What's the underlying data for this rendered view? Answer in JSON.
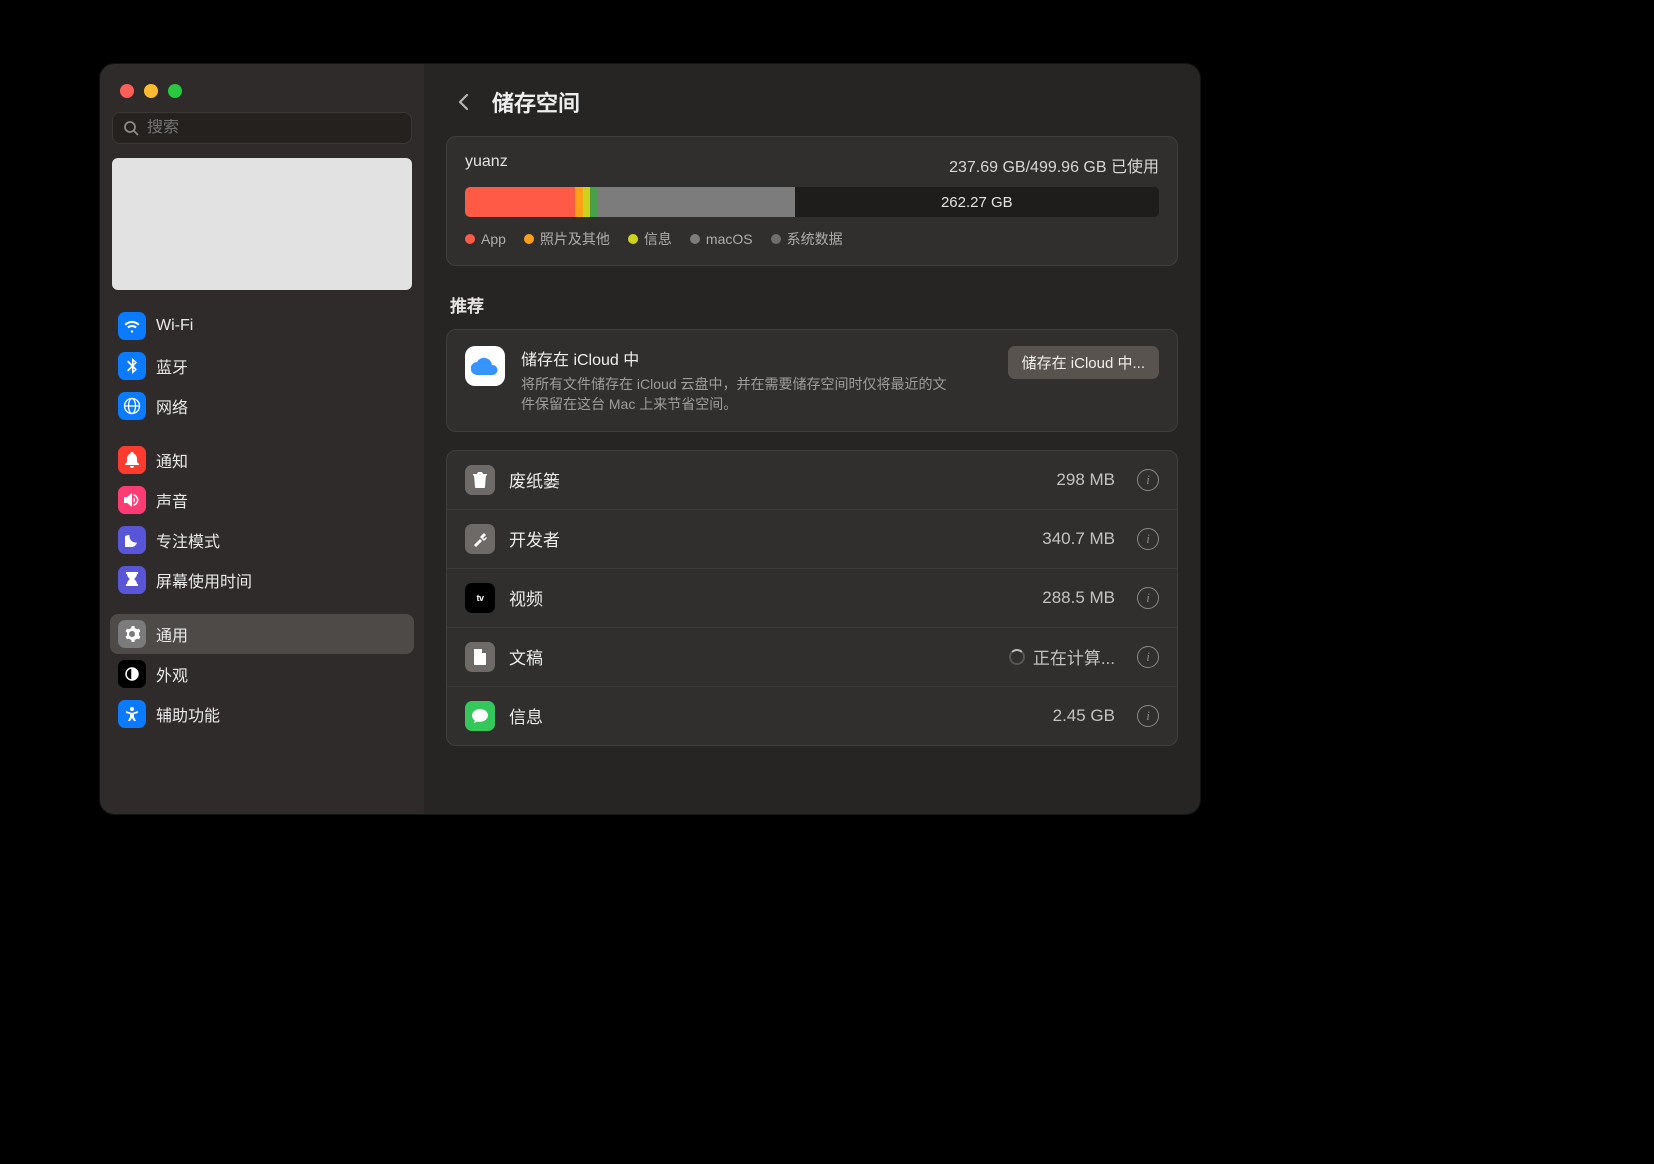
{
  "search": {
    "placeholder": "搜索"
  },
  "sidebar": {
    "items": [
      {
        "label": "Wi-Fi",
        "icon": "wifi"
      },
      {
        "label": "蓝牙",
        "icon": "bt"
      },
      {
        "label": "网络",
        "icon": "net"
      },
      {
        "label": "通知",
        "icon": "notif"
      },
      {
        "label": "声音",
        "icon": "sound"
      },
      {
        "label": "专注模式",
        "icon": "focus"
      },
      {
        "label": "屏幕使用时间",
        "icon": "screentime"
      },
      {
        "label": "通用",
        "icon": "general",
        "selected": true
      },
      {
        "label": "外观",
        "icon": "appearance"
      },
      {
        "label": "辅助功能",
        "icon": "access"
      }
    ]
  },
  "header": {
    "title": "储存空间"
  },
  "storage": {
    "disk_name": "yuanz",
    "used_label": "237.69 GB/499.96 GB 已使用",
    "free_label": "262.27 GB",
    "segments": {
      "app_pct": 15.8,
      "photos_pct": 1.2,
      "msg_pct": 1.0,
      "macos_pct": 1.0,
      "sys_pct": 28.5
    },
    "legend": {
      "app": "App",
      "photos": "照片及其他",
      "msg": "信息",
      "macos": "macOS",
      "sys": "系统数据"
    }
  },
  "recommend": {
    "section": "推荐",
    "title": "储存在 iCloud 中",
    "desc": "将所有文件储存在 iCloud 云盘中，并在需要储存空间时仅将最近的文件保留在这台 Mac 上来节省空间。",
    "button": "储存在 iCloud 中..."
  },
  "rows": [
    {
      "icon": "trash",
      "label": "废纸篓",
      "value": "298 MB"
    },
    {
      "icon": "dev",
      "label": "开发者",
      "value": "340.7 MB"
    },
    {
      "icon": "tv",
      "label": "视频",
      "value": "288.5 MB"
    },
    {
      "icon": "doc",
      "label": "文稿",
      "value": "正在计算...",
      "computing": true
    },
    {
      "icon": "msg",
      "label": "信息",
      "value": "2.45 GB"
    }
  ]
}
